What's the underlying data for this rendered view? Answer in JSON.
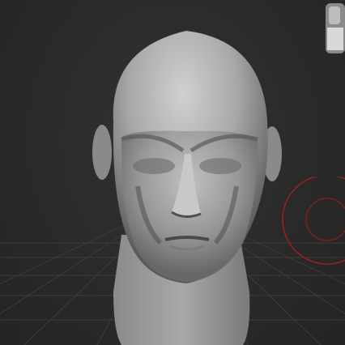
{
  "viewport": {
    "title": "",
    "background_color": "#2a2a2a",
    "grid_color": "#3f3f3f",
    "model": {
      "name": "head-bust",
      "material_color": "#b8b8b8",
      "highlight_color": "#d8d8d8",
      "shadow_color": "#4a4a4a"
    },
    "nav_cube": {
      "icon": "view-orientation-head-icon"
    },
    "brush_cursor": {
      "icon": "brush-radius-circle-icon",
      "color": "#a02020"
    }
  }
}
